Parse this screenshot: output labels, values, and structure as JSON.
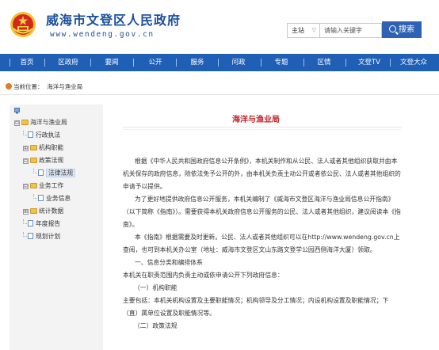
{
  "header": {
    "title": "威海市文登区人民政府",
    "url": "www.wendeng.gov.cn",
    "search": {
      "scope": "主站",
      "placeholder": "请输入关键字",
      "button_label": "搜索"
    }
  },
  "nav": {
    "items": [
      "首页",
      "区政府",
      "要闻",
      "公开",
      "服务",
      "问政",
      "专题",
      "区情",
      "文登TV",
      "文登大众"
    ]
  },
  "breadcrumb": {
    "prefix": "当前位置：",
    "current": "海洋与渔业局"
  },
  "sidebar": {
    "items": [
      {
        "label": "海洋与渔业局",
        "type": "folder",
        "expander": "⊟"
      },
      {
        "label": "行政执法",
        "type": "page"
      },
      {
        "label": "机构职能",
        "type": "folder",
        "expander": "⊞"
      },
      {
        "label": "政策法规",
        "type": "folder",
        "expander": "⊟"
      },
      {
        "label": "法律法规",
        "type": "page",
        "selected": true
      },
      {
        "label": "业务工作",
        "type": "folder",
        "expander": "⊟"
      },
      {
        "label": "业务信息",
        "type": "page"
      },
      {
        "label": "统计数据",
        "type": "folder",
        "expander": "⊞"
      },
      {
        "label": "年度报告",
        "type": "page"
      },
      {
        "label": "规划计划",
        "type": "page"
      }
    ]
  },
  "content": {
    "title": "海洋与渔业局",
    "paragraphs": [
      "根据《中华人民共和国政府信息公开条例》，本机关制作和从公民、法人或者其他组织获取并由本机关保存的政府信息，除依法免予公开的外，由本机关负责主动公开或者依公民、法人或者其他组织的申请予以提供。",
      "为了更好地提供政府信息公开服务，本机关编制了《威海市文登区海洋与渔业局信息公开指南》（以下简称《指南》）。需要获得本机关政府信息公开服务的公民、法人或者其他组织，建议阅读本《指南》。",
      "本《指南》根据需要及时更新。公民、法人或者其他组织可以在http://www.wendeng.gov.cn上查阅，也可到本机关办公室（地址：威海市文登区文山东路文登学公园西侧海洋大厦）领取。",
      "一、信息分类和编排体系",
      "本机关在职责范围内负责主动或依申请公开下列政府信息：",
      "（一）机构职能",
      "主要包括：本机关机构设置及主要职能情况；机构领导及分工情况；内设机构设置及职能情况；下（直）属单位设置及职能情况等。",
      "（二）政策法规"
    ]
  }
}
